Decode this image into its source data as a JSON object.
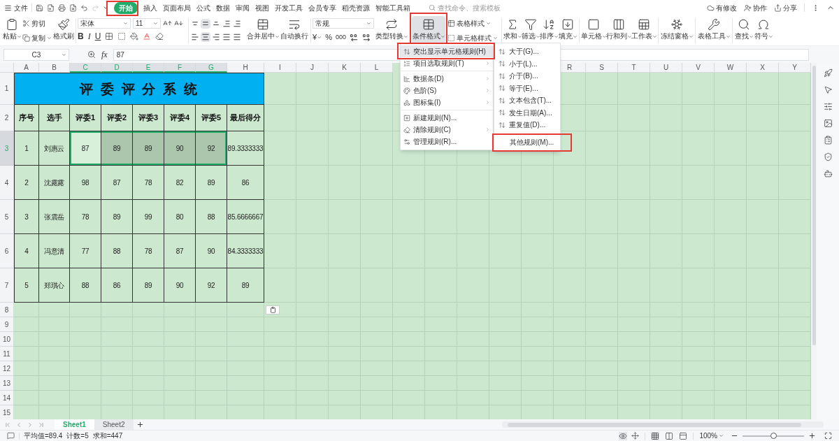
{
  "menu_bar": {
    "file": "文件",
    "tabs": [
      {
        "label": "开始",
        "selected": true
      },
      {
        "label": "插入",
        "selected": false
      },
      {
        "label": "页面布局",
        "selected": false
      },
      {
        "label": "公式",
        "selected": false
      },
      {
        "label": "数据",
        "selected": false
      },
      {
        "label": "审阅",
        "selected": false
      },
      {
        "label": "视图",
        "selected": false
      },
      {
        "label": "开发工具",
        "selected": false
      },
      {
        "label": "会员专享",
        "selected": false
      },
      {
        "label": "稻壳资源",
        "selected": false
      },
      {
        "label": "智能工具箱",
        "selected": false
      }
    ],
    "search_placeholder": "查找命令、搜索模板",
    "actions": [
      "有修改",
      "协作",
      "分享"
    ]
  },
  "ribbon": {
    "paste": "粘贴",
    "cut": "剪切",
    "copy": "复制",
    "format_painter": "格式刷",
    "font_name": "宋体",
    "font_size": "11",
    "styles": [
      "B",
      "I",
      "U"
    ],
    "merge": "合并居中",
    "wrap": "自动换行",
    "number_format": "常规",
    "currency": "¥",
    "percent": "%",
    "thousands": "000",
    "convert": "类型转换",
    "conditional_format": {
      "label": "条件格式",
      "selected": true
    },
    "table_style": "表格样式",
    "cell_style": "单元格样式",
    "tools": [
      "求和",
      "筛选",
      "排序",
      "填充",
      "单元格",
      "行和列",
      "工作表",
      "冻结窗格",
      "表格工具",
      "查找",
      "符号"
    ]
  },
  "formula_bar": {
    "cell": "C3",
    "fx": "fx",
    "value": "87"
  },
  "sheet": {
    "columns": [
      {
        "label": "A",
        "selected": false
      },
      {
        "label": "B",
        "selected": false
      },
      {
        "label": "C",
        "selected": true
      },
      {
        "label": "D",
        "selected": true
      },
      {
        "label": "E",
        "selected": true
      },
      {
        "label": "F",
        "selected": true
      },
      {
        "label": "G",
        "selected": true
      },
      {
        "label": "H",
        "selected": false
      },
      {
        "label": "I",
        "selected": false
      },
      {
        "label": "J",
        "selected": false
      },
      {
        "label": "K",
        "selected": false
      },
      {
        "label": "L",
        "selected": false
      }
    ],
    "columns_right": [
      {
        "label": "R",
        "selected": false
      },
      {
        "label": "S",
        "selected": false
      },
      {
        "label": "T",
        "selected": false
      },
      {
        "label": "U",
        "selected": false
      },
      {
        "label": "V",
        "selected": false
      },
      {
        "label": "W",
        "selected": false
      },
      {
        "label": "X",
        "selected": false
      },
      {
        "label": "Y",
        "selected": false
      }
    ],
    "rows": [
      {
        "label": "1",
        "selected": false
      },
      {
        "label": "2",
        "selected": false
      },
      {
        "label": "3",
        "selected": true
      },
      {
        "label": "4",
        "selected": false
      },
      {
        "label": "5",
        "selected": false
      },
      {
        "label": "6",
        "selected": false
      },
      {
        "label": "7",
        "selected": false
      },
      {
        "label": "8",
        "selected": false
      },
      {
        "label": "9",
        "selected": false
      },
      {
        "label": "10",
        "selected": false
      },
      {
        "label": "11",
        "selected": false
      },
      {
        "label": "12",
        "selected": false
      },
      {
        "label": "13",
        "selected": false
      },
      {
        "label": "14",
        "selected": false
      },
      {
        "label": "15",
        "selected": false
      }
    ],
    "table": {
      "title": "评 委 评 分 系 统",
      "header": [
        "序号",
        "选手",
        "评委1",
        "评委2",
        "评委3",
        "评委4",
        "评委5",
        "最后得分"
      ],
      "records": [
        {
          "cells": [
            {
              "text": "1",
              "highlighted": false,
              "selected": false
            },
            {
              "text": "刘惠云",
              "highlighted": false,
              "selected": false
            },
            {
              "text": "87",
              "highlighted": false,
              "selected": true
            },
            {
              "text": "89",
              "highlighted": true,
              "selected": true
            },
            {
              "text": "89",
              "highlighted": true,
              "selected": true
            },
            {
              "text": "90",
              "highlighted": true,
              "selected": true
            },
            {
              "text": "92",
              "highlighted": true,
              "selected": true
            },
            {
              "text": "89.3333333",
              "highlighted": false,
              "selected": false
            }
          ]
        },
        {
          "cells": [
            {
              "text": "2",
              "highlighted": false,
              "selected": false
            },
            {
              "text": "沈露露",
              "highlighted": false,
              "selected": false
            },
            {
              "text": "98",
              "highlighted": false,
              "selected": false
            },
            {
              "text": "87",
              "highlighted": false,
              "selected": false
            },
            {
              "text": "78",
              "highlighted": false,
              "selected": false
            },
            {
              "text": "82",
              "highlighted": false,
              "selected": false
            },
            {
              "text": "89",
              "highlighted": false,
              "selected": false
            },
            {
              "text": "86",
              "highlighted": false,
              "selected": false
            }
          ]
        },
        {
          "cells": [
            {
              "text": "3",
              "highlighted": false,
              "selected": false
            },
            {
              "text": "张震岳",
              "highlighted": false,
              "selected": false
            },
            {
              "text": "78",
              "highlighted": false,
              "selected": false
            },
            {
              "text": "89",
              "highlighted": false,
              "selected": false
            },
            {
              "text": "99",
              "highlighted": false,
              "selected": false
            },
            {
              "text": "80",
              "highlighted": false,
              "selected": false
            },
            {
              "text": "88",
              "highlighted": false,
              "selected": false
            },
            {
              "text": "85.6666667",
              "highlighted": false,
              "selected": false
            }
          ]
        },
        {
          "cells": [
            {
              "text": "4",
              "highlighted": false,
              "selected": false
            },
            {
              "text": "冯意清",
              "highlighted": false,
              "selected": false
            },
            {
              "text": "77",
              "highlighted": false,
              "selected": false
            },
            {
              "text": "88",
              "highlighted": false,
              "selected": false
            },
            {
              "text": "78",
              "highlighted": false,
              "selected": false
            },
            {
              "text": "87",
              "highlighted": false,
              "selected": false
            },
            {
              "text": "90",
              "highlighted": false,
              "selected": false
            },
            {
              "text": "84.3333333",
              "highlighted": false,
              "selected": false
            }
          ]
        },
        {
          "cells": [
            {
              "text": "5",
              "highlighted": false,
              "selected": false
            },
            {
              "text": "郑琪心",
              "highlighted": false,
              "selected": false
            },
            {
              "text": "88",
              "highlighted": false,
              "selected": false
            },
            {
              "text": "86",
              "highlighted": false,
              "selected": false
            },
            {
              "text": "89",
              "highlighted": false,
              "selected": false
            },
            {
              "text": "90",
              "highlighted": false,
              "selected": false
            },
            {
              "text": "92",
              "highlighted": false,
              "selected": false
            },
            {
              "text": "89",
              "highlighted": false,
              "selected": false
            }
          ]
        }
      ]
    }
  },
  "format_menu": {
    "groups": [
      [
        {
          "label": "突出显示单元格规则(H)",
          "submenu": true,
          "selected": true
        },
        {
          "label": "项目选取规则(T)",
          "submenu": true,
          "selected": false
        }
      ],
      [
        {
          "label": "数据条(D)",
          "submenu": true,
          "selected": false
        },
        {
          "label": "色阶(S)",
          "submenu": true,
          "selected": false
        },
        {
          "label": "图标集(I)",
          "submenu": true,
          "selected": false
        }
      ],
      [
        {
          "label": "新建规则(N)...",
          "submenu": false,
          "selected": false
        },
        {
          "label": "清除规则(C)",
          "submenu": true,
          "selected": false
        },
        {
          "label": "管理规则(R)...",
          "submenu": false,
          "selected": false
        }
      ]
    ]
  },
  "rule_submenu": {
    "items": [
      "大于(G)...",
      "小于(L)...",
      "介于(B)...",
      "等于(E)...",
      "文本包含(T)...",
      "发生日期(A)...",
      "重复值(D)..."
    ],
    "more": "其他规则(M)..."
  },
  "sheet_tabs": [
    {
      "label": "Sheet1",
      "selected": true
    },
    {
      "label": "Sheet2",
      "selected": false
    }
  ],
  "status_bar": {
    "stats": [
      "平均值=89.4",
      "计数=5",
      "求和=447"
    ],
    "zoom": "100%",
    "zoom_slider": {
      "level": 0.5
    }
  }
}
